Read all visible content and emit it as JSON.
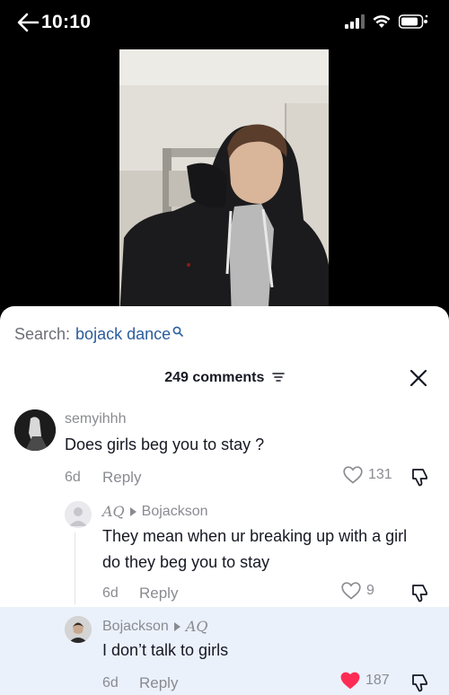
{
  "status": {
    "time": "10:10",
    "icons": [
      "back-arrow-icon",
      "signal-icon",
      "wifi-icon",
      "battery-icon"
    ]
  },
  "sheet": {
    "search_label": "Search:",
    "search_query": "bojack dance",
    "comments_count": "249 comments"
  },
  "comments": [
    {
      "username": "semyihhh",
      "text": "Does girls beg you to stay ?",
      "age": "6d",
      "reply_label": "Reply",
      "likes": "131",
      "liked": false
    },
    {
      "username": "AQ",
      "reply_to": "Bojackson",
      "text": "They mean when ur breaking up with a girl do they beg you to stay",
      "age": "6d",
      "reply_label": "Reply",
      "likes": "9",
      "liked": false
    },
    {
      "username": "Bojackson",
      "reply_to": "AQ",
      "text": "I don’t talk to girls",
      "age": "6d",
      "reply_label": "Reply",
      "likes": "187",
      "liked": true
    }
  ],
  "colors": {
    "accent_link": "#2b5d9c",
    "liked_heart": "#fe2c55",
    "highlight_bg": "#ebf1fb"
  }
}
